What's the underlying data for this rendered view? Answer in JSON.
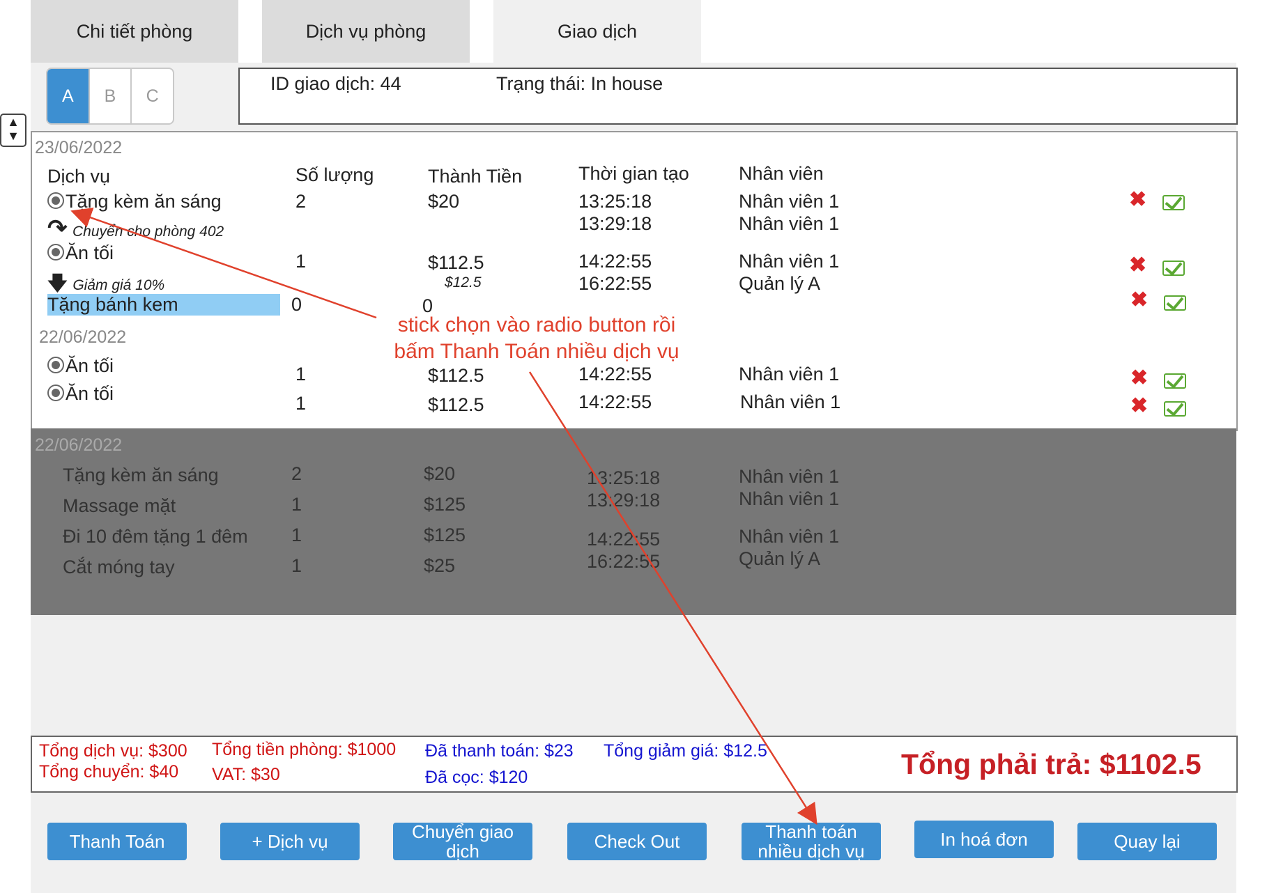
{
  "tabs": [
    "Chi tiết phòng",
    "Dịch vụ phòng",
    "Giao dịch"
  ],
  "segments": [
    "A",
    "B",
    "C"
  ],
  "info": {
    "transaction_id": "ID giao dịch: 44",
    "status": "Trạng thái: In house"
  },
  "headers": {
    "service": "Dịch vụ",
    "qty": "Số lượng",
    "amount": "Thành Tiền",
    "time": "Thời gian tạo",
    "staff": "Nhân viên"
  },
  "groups": [
    {
      "date": "23/06/2022",
      "rows": [
        {
          "name": "Tặng kèm ăn sáng",
          "qty": "2",
          "amount": "$20",
          "time1": "13:25:18",
          "time2": "13:29:18",
          "staff1": "Nhân viên 1",
          "staff2": "Nhân viên 1",
          "note": "Chuyển cho phòng 402"
        },
        {
          "name": "Ăn tối",
          "qty": "1",
          "amount": "$112.5",
          "discount": "$12.5",
          "time1": "14:22:55",
          "time2": "16:22:55",
          "staff1": "Nhân viên 1",
          "staff2": "Quản lý A",
          "note": "Giảm giá 10%"
        },
        {
          "name": "Tặng bánh kem",
          "qty": "0",
          "amount": "0"
        }
      ]
    },
    {
      "date": "22/06/2022",
      "rows": [
        {
          "name": "Ăn tối",
          "qty": "1",
          "amount": "$112.5",
          "time1": "14:22:55",
          "staff1": "Nhân viên 1"
        },
        {
          "name": "Ăn tối",
          "qty": "1",
          "amount": "$112.5",
          "time1": "14:22:55",
          "staff1": "Nhân viên 1"
        }
      ]
    }
  ],
  "history": {
    "date": "22/06/2022",
    "rows": [
      {
        "name": "Tặng kèm ăn sáng",
        "qty": "2",
        "amount": "$20"
      },
      {
        "name": "Massage mặt",
        "qty": "1",
        "amount": "$125"
      },
      {
        "name": "Đi 10 đêm tặng 1 đêm",
        "qty": "1",
        "amount": "$125"
      },
      {
        "name": "Cắt móng tay",
        "qty": "1",
        "amount": "$25"
      }
    ],
    "times": [
      "13:25:18",
      "13:29:18",
      "14:22:55",
      "16:22:55"
    ],
    "staff": [
      "Nhân viên 1",
      "Nhân viên 1",
      "Nhân viên 1",
      "Quản lý A"
    ]
  },
  "totals": {
    "services": "Tổng dịch vụ: $300",
    "transfer": "Tổng chuyển: $40",
    "room": "Tổng tiền phòng: $1000",
    "vat": "VAT: $30",
    "paid": "Đã thanh toán: $23",
    "deposit": "Đã cọc: $120",
    "discount": "Tổng giảm giá: $12.5",
    "grand": "Tổng phải trả: $1102.5"
  },
  "buttons": {
    "pay": "Thanh Toán",
    "add_service": "+ Dịch vụ",
    "transfer_1": "Chuyển giao",
    "transfer_2": "dịch",
    "checkout": "Check Out",
    "pay_multi_1": "Thanh toán",
    "pay_multi_2": "nhiều dịch vụ",
    "print": "In hoá đơn",
    "back": "Quay lại"
  },
  "annotation": {
    "line1": "stick chọn vào radio button rồi",
    "line2": "bấm Thanh Toán nhiều dịch vụ"
  },
  "colors": {
    "accent": "#3d8fd1",
    "highlight": "#90cdf4",
    "danger": "#d9262a",
    "ok": "#5aa832",
    "annotation": "#e0412c"
  }
}
